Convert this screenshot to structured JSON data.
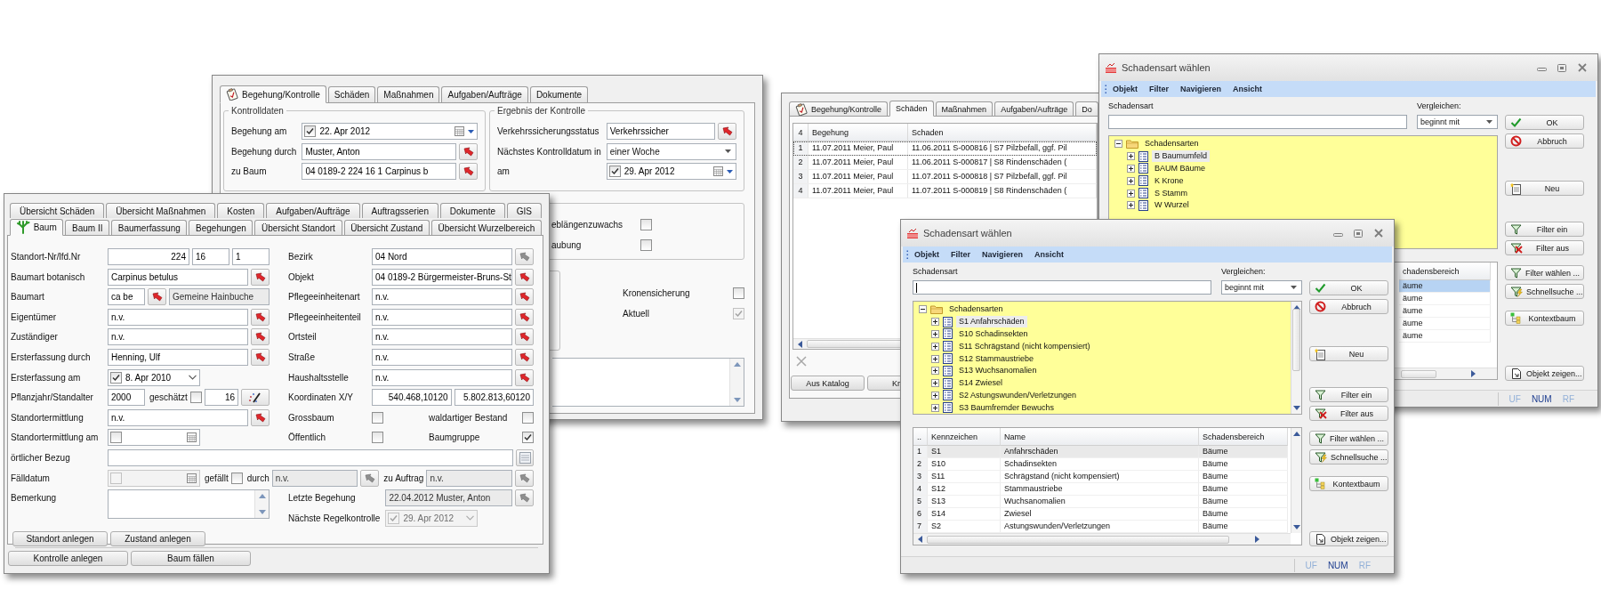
{
  "kontrolle_window": {
    "tabs": [
      {
        "label": "Begehung/Kontrolle",
        "selected": true
      },
      {
        "label": "Schäden",
        "selected": false
      },
      {
        "label": "Maßnahmen",
        "selected": false
      },
      {
        "label": "Aufgaben/Aufträge",
        "selected": false
      },
      {
        "label": "Dokumente",
        "selected": false
      }
    ],
    "groups": [
      {
        "title": "Kontrolldaten",
        "rows": [
          {
            "kind": "fields",
            "label": "Begehung am",
            "controls": [
              {
                "kind": "date-calendar-dropdown",
                "value": "22. Apr 2012",
                "checked": true,
                "disabled": false
              }
            ]
          },
          {
            "kind": "fields",
            "label": "Begehung durch",
            "controls": [
              {
                "kind": "field",
                "value": "Muster, Anton",
                "readonly": false
              },
              {
                "kind": "lookup",
                "disabled": false
              }
            ]
          },
          {
            "kind": "fields",
            "label": "zu Baum",
            "controls": [
              {
                "kind": "field",
                "value": "04 0189-2 224 16 1 Carpinus b",
                "readonly": false
              },
              {
                "kind": "lookup",
                "disabled": false
              }
            ]
          }
        ]
      },
      {
        "title": "Ergebnis der Kontrolle",
        "rows": [
          {
            "kind": "fields",
            "label": "Verkehrssicherungsstatus",
            "controls": [
              {
                "kind": "field",
                "value": "Verkehrssicher",
                "readonly": false
              },
              {
                "kind": "lookup",
                "disabled": false
              }
            ]
          },
          {
            "kind": "fields",
            "label": "Nächstes Kontrolldatum in",
            "controls": [
              {
                "kind": "combo",
                "value": "einer Woche"
              }
            ]
          },
          {
            "kind": "fields",
            "label": "am",
            "controls": [
              {
                "kind": "date-calendar-dropdown",
                "value": "29. Apr 2012",
                "checked": true,
                "disabled": false
              }
            ]
          }
        ]
      }
    ],
    "growth_checks": [
      {
        "label": "eblängenzuwachs",
        "checked": false
      },
      {
        "label": "aubung",
        "checked": false
      }
    ],
    "flags": [
      {
        "label": "Kronensicherung",
        "checked": false,
        "disabled": false
      },
      {
        "label": "Aktuell",
        "checked": true,
        "disabled": true
      }
    ]
  },
  "baum_window": {
    "tab_rows": [
      [
        {
          "label": "Übersicht Schäden",
          "selected": false
        },
        {
          "label": "Übersicht Maßnahmen",
          "selected": false
        },
        {
          "label": "Kosten",
          "selected": false
        },
        {
          "label": "Aufgaben/Aufträge",
          "selected": false
        },
        {
          "label": "Auftragsserien",
          "selected": false
        },
        {
          "label": "Dokumente",
          "selected": false
        },
        {
          "label": "GIS",
          "selected": false
        }
      ],
      [
        {
          "label": "Baum",
          "selected": true
        },
        {
          "label": "Baum II",
          "selected": false
        },
        {
          "label": "Baumerfassung",
          "selected": false
        },
        {
          "label": "Begehungen",
          "selected": false
        },
        {
          "label": "Übersicht Standort",
          "selected": false
        },
        {
          "label": "Übersicht Zustand",
          "selected": false
        },
        {
          "label": "Übersicht Wurzelbereich",
          "selected": false
        }
      ]
    ],
    "sections": [
      {
        "kind": "columns",
        "columns": [
          [
            {
              "kind": "fields",
              "label": "Standort-Nr/lfd.Nr",
              "controls": [
                {
                  "kind": "number",
                  "value": "224",
                  "readonly": false
                },
                {
                  "kind": "code",
                  "value": "16",
                  "readonly": false
                },
                {
                  "kind": "code",
                  "value": "1",
                  "readonly": false
                }
              ]
            },
            {
              "kind": "fields",
              "label": "Baumart botanisch",
              "controls": [
                {
                  "kind": "field",
                  "value": "Carpinus betulus",
                  "readonly": false
                },
                {
                  "kind": "lookup",
                  "disabled": false
                }
              ]
            },
            {
              "kind": "fields",
              "label": "Baumart",
              "controls": [
                {
                  "kind": "code",
                  "value": "ca be",
                  "readonly": false
                },
                {
                  "kind": "lookup",
                  "disabled": false
                },
                {
                  "kind": "field",
                  "value": "Gemeine Hainbuche",
                  "readonly": true
                }
              ]
            },
            {
              "kind": "fields",
              "label": "Eigentümer",
              "controls": [
                {
                  "kind": "field",
                  "value": "n.v.",
                  "readonly": false
                },
                {
                  "kind": "lookup",
                  "disabled": false
                }
              ]
            },
            {
              "kind": "fields",
              "label": "Zuständiger",
              "controls": [
                {
                  "kind": "field",
                  "value": "n.v.",
                  "readonly": false
                },
                {
                  "kind": "lookup",
                  "disabled": false
                }
              ]
            },
            {
              "kind": "fields",
              "label": "Ersterfassung durch",
              "controls": [
                {
                  "kind": "field",
                  "value": "Henning, Ulf",
                  "readonly": false
                },
                {
                  "kind": "lookup",
                  "disabled": false
                }
              ]
            },
            {
              "kind": "fields",
              "label": "Ersterfassung am",
              "controls": [
                {
                  "kind": "date-dropdown",
                  "value": "8. Apr 2010",
                  "checked": true,
                  "disabled": false
                }
              ]
            },
            {
              "kind": "fields",
              "label": "Pflanzjahr/Standalter",
              "controls": [
                {
                  "kind": "code",
                  "value": "2000",
                  "readonly": false
                },
                {
                  "kind": "caption",
                  "label": "geschätzt"
                },
                {
                  "kind": "check",
                  "checked": false
                },
                {
                  "kind": "number",
                  "value": "16",
                  "readonly": false
                },
                {
                  "kind": "tool"
                }
              ]
            },
            {
              "kind": "fields",
              "label": "Standortermittlung",
              "controls": [
                {
                  "kind": "field",
                  "value": "n.v.",
                  "readonly": false
                },
                {
                  "kind": "lookup",
                  "disabled": false
                }
              ]
            },
            {
              "kind": "fields",
              "label": "Standortermittlung am",
              "controls": [
                {
                  "kind": "date-calendar",
                  "checked": false,
                  "disabled": false
                }
              ]
            }
          ],
          [
            {
              "kind": "fields",
              "label": "Bezirk",
              "controls": [
                {
                  "kind": "field",
                  "value": "04 Nord",
                  "readonly": false
                },
                {
                  "kind": "lookup",
                  "disabled": true
                }
              ]
            },
            {
              "kind": "fields",
              "label": "Objekt",
              "controls": [
                {
                  "kind": "field",
                  "value": "04 0189-2 Bürgermeister-Bruns-St",
                  "readonly": false
                },
                {
                  "kind": "lookup",
                  "disabled": false
                }
              ]
            },
            {
              "kind": "fields",
              "label": "Pflegeeinheitenart",
              "controls": [
                {
                  "kind": "field",
                  "value": "n.v.",
                  "readonly": false
                },
                {
                  "kind": "lookup",
                  "disabled": false
                }
              ]
            },
            {
              "kind": "fields",
              "label": "Pflegeeinheitenteil",
              "controls": [
                {
                  "kind": "field",
                  "value": "n.v.",
                  "readonly": false
                },
                {
                  "kind": "lookup",
                  "disabled": false
                }
              ]
            },
            {
              "kind": "fields",
              "label": "Ortsteil",
              "controls": [
                {
                  "kind": "field",
                  "value": "n.v.",
                  "readonly": false
                },
                {
                  "kind": "lookup",
                  "disabled": false
                }
              ]
            },
            {
              "kind": "fields",
              "label": "Straße",
              "controls": [
                {
                  "kind": "field",
                  "value": "n.v.",
                  "readonly": false
                },
                {
                  "kind": "lookup",
                  "disabled": false
                }
              ]
            },
            {
              "kind": "fields",
              "label": "Haushaltsstelle",
              "controls": [
                {
                  "kind": "field",
                  "value": "n.v.",
                  "readonly": false
                },
                {
                  "kind": "lookup",
                  "disabled": false
                }
              ]
            },
            {
              "kind": "fields",
              "label": "Koordinaten X/Y",
              "controls": [
                {
                  "kind": "number",
                  "value": "540.468,10120",
                  "readonly": false
                },
                {
                  "kind": "number",
                  "value": "5.802.813,60120",
                  "readonly": false
                }
              ]
            },
            {
              "kind": "checks",
              "label": "Grossbaum",
              "controls": [
                {
                  "kind": "check",
                  "checked": false
                },
                {
                  "kind": "caption",
                  "label": "waldartiger Bestand"
                },
                {
                  "kind": "check",
                  "checked": false
                }
              ]
            },
            {
              "kind": "checks",
              "label": "Öffentlich",
              "controls": [
                {
                  "kind": "check",
                  "checked": false
                },
                {
                  "kind": "caption",
                  "label": "Baumgruppe"
                },
                {
                  "kind": "check",
                  "checked": true
                }
              ]
            }
          ]
        ]
      },
      {
        "kind": "wide",
        "rows": [
          {
            "kind": "fields",
            "label": "örtlicher Bezug",
            "controls": [
              {
                "kind": "field",
                "readonly": false
              },
              {
                "kind": "note"
              }
            ]
          },
          {
            "kind": "fields",
            "label": "Fälldatum",
            "controls": [
              {
                "kind": "date-calendar",
                "checked": false,
                "disabled": true
              },
              {
                "kind": "caption",
                "label": "gefällt"
              },
              {
                "kind": "check",
                "checked": false
              },
              {
                "kind": "caption",
                "label": "durch"
              },
              {
                "kind": "field",
                "value": "n.v.",
                "readonly": true
              },
              {
                "kind": "lookup",
                "disabled": true
              },
              {
                "kind": "caption",
                "label": "zu Auftrag"
              },
              {
                "kind": "field",
                "value": "n.v.",
                "readonly": true
              },
              {
                "kind": "lookup",
                "disabled": true
              }
            ]
          }
        ]
      },
      {
        "kind": "columns",
        "columns": [
          [
            {
              "kind": "fields",
              "label": "Bemerkung",
              "controls": [
                {
                  "kind": "memo"
                }
              ]
            }
          ],
          [
            {
              "kind": "fields",
              "label": "Letzte Begehung",
              "controls": [
                {
                  "kind": "field",
                  "value": "22.04.2012 Muster, Anton",
                  "readonly": true
                },
                {
                  "kind": "lookup",
                  "disabled": true
                }
              ]
            },
            {
              "kind": "fields",
              "label": "Nächste Regelkontrolle",
              "controls": [
                {
                  "kind": "date-dropdown",
                  "value": "29. Apr 2012",
                  "checked": true,
                  "disabled": true
                }
              ]
            }
          ]
        ]
      }
    ],
    "actions": [
      "Standort anlegen",
      "Zustand anlegen"
    ],
    "footer_actions": [
      "Kontrolle anlegen",
      "Baum fällen"
    ]
  },
  "schaeden_window": {
    "tabs": [
      {
        "label": "Begehung/Kontrolle",
        "selected": false
      },
      {
        "label": "Schäden",
        "selected": true
      },
      {
        "label": "Maßnahmen",
        "selected": false
      },
      {
        "label": "Aufgaben/Aufträge",
        "selected": false
      },
      {
        "label": "Do",
        "selected": false
      }
    ],
    "grid": {
      "columns": [
        "4",
        "Begehung",
        "Schaden"
      ],
      "rows": [
        {
          "cells": [
            "1",
            "11.07.2011 Meier, Paul",
            "11.06.2011 S-000816 | S7 Pilzbefall, ggf. Pil"
          ],
          "selected": true
        },
        {
          "cells": [
            "2",
            "11.07.2011 Meier, Paul",
            "11.06.2011 S-000817 | S8 Rindenschäden ("
          ],
          "selected": false
        },
        {
          "cells": [
            "3",
            "11.07.2011 Meier, Paul",
            "11.07.2011 S-000818 | S7 Pilzbefall, ggf. Pil"
          ],
          "selected": false
        },
        {
          "cells": [
            "4",
            "11.07.2011 Meier, Paul",
            "11.07.2011 S-000819 | S8 Rindenschäden ("
          ],
          "selected": false
        }
      ]
    },
    "buttons": [
      "Aus Katalog",
      "Kr"
    ]
  },
  "schadensart_window_back": {
    "title": "Schadensart wählen",
    "menu": [
      "Objekt",
      "Filter",
      "Navigieren",
      "Ansicht"
    ],
    "search_label": "Schadensart",
    "compare_label": "Vergleichen:",
    "compare_value": "beginnt mit",
    "tree": {
      "label": "Schadensarten",
      "expanded": true,
      "selected": false,
      "children": [
        {
          "label": "B Baumumfeld",
          "expanded": false,
          "selected": true
        },
        {
          "label": "BAUM Bäume",
          "expanded": false,
          "selected": false
        },
        {
          "label": "K Krone",
          "expanded": false,
          "selected": false
        },
        {
          "label": "S Stamm",
          "expanded": false,
          "selected": false
        },
        {
          "label": "W Wurzel",
          "expanded": false,
          "selected": false
        }
      ]
    },
    "grid": {
      "columns": [
        "chadensbereich"
      ],
      "rows": [
        {
          "cells": [
            "äume"
          ],
          "selected": true
        },
        {
          "cells": [
            "äume"
          ],
          "selected": false
        },
        {
          "cells": [
            "äume"
          ],
          "selected": false
        },
        {
          "cells": [
            "äume"
          ],
          "selected": false
        },
        {
          "cells": [
            "äume"
          ],
          "selected": false
        }
      ]
    },
    "buttons": [
      {
        "kind": "ok",
        "label": "OK"
      },
      {
        "kind": "cancel",
        "label": "Abbruch"
      },
      {
        "kind": "new",
        "label": "Neu"
      },
      {
        "kind": "filter-on",
        "label": "Filter ein"
      },
      {
        "kind": "filter-off",
        "label": "Filter aus"
      },
      {
        "kind": "filter-choose",
        "label": "Filter wählen ..."
      },
      {
        "kind": "quick-search",
        "label": "Schnellsuche ..."
      },
      {
        "kind": "context-tree",
        "label": "Kontextbaum"
      },
      {
        "kind": "show-object",
        "label": "Objekt zeigen..."
      }
    ],
    "status": [
      {
        "label": "UF",
        "on": false
      },
      {
        "label": "NUM",
        "on": true
      },
      {
        "label": "RF",
        "on": false
      }
    ]
  },
  "schadensart_window_front": {
    "title": "Schadensart wählen",
    "menu": [
      "Objekt",
      "Filter",
      "Navigieren",
      "Ansicht"
    ],
    "search_label": "Schadensart",
    "compare_label": "Vergleichen:",
    "compare_value": "beginnt mit",
    "tree": {
      "label": "Schadensarten",
      "expanded": true,
      "selected": false,
      "children": [
        {
          "label": "S1 Anfahrschäden",
          "expanded": false,
          "selected": true
        },
        {
          "label": "S10 Schadinsekten",
          "expanded": false,
          "selected": false
        },
        {
          "label": "S11 Schrägstand (nicht kompensiert)",
          "expanded": false,
          "selected": false
        },
        {
          "label": "S12 Stammaustriebe",
          "expanded": false,
          "selected": false
        },
        {
          "label": "S13 Wuchsanomalien",
          "expanded": false,
          "selected": false
        },
        {
          "label": "S14 Zwiesel",
          "expanded": false,
          "selected": false
        },
        {
          "label": "S2 Astungswunden/Verletzungen",
          "expanded": false,
          "selected": false
        },
        {
          "label": "S3 Baumfremder Bewuchs",
          "expanded": false,
          "selected": false
        }
      ]
    },
    "grid": {
      "columns": [
        "..",
        "Kennzeichen",
        "Name",
        "Schadensbereich"
      ],
      "rows": [
        {
          "cells": [
            "1",
            "S1",
            "Anfahrschäden",
            "Bäume"
          ],
          "selected": true
        },
        {
          "cells": [
            "2",
            "S10",
            "Schadinsekten",
            "Bäume"
          ],
          "selected": false
        },
        {
          "cells": [
            "3",
            "S11",
            "Schrägstand (nicht kompensiert)",
            "Bäume"
          ],
          "selected": false
        },
        {
          "cells": [
            "4",
            "S12",
            "Stammaustriebe",
            "Bäume"
          ],
          "selected": false
        },
        {
          "cells": [
            "5",
            "S13",
            "Wuchsanomalien",
            "Bäume"
          ],
          "selected": false
        },
        {
          "cells": [
            "6",
            "S14",
            "Zwiesel",
            "Bäume"
          ],
          "selected": false
        },
        {
          "cells": [
            "7",
            "S2",
            "Astungswunden/Verletzungen",
            "Bäume"
          ],
          "selected": false
        }
      ]
    },
    "buttons": [
      {
        "kind": "ok",
        "label": "OK"
      },
      {
        "kind": "cancel",
        "label": "Abbruch"
      },
      {
        "kind": "new",
        "label": "Neu"
      },
      {
        "kind": "filter-on",
        "label": "Filter ein"
      },
      {
        "kind": "filter-off",
        "label": "Filter aus"
      },
      {
        "kind": "filter-choose",
        "label": "Filter wählen ..."
      },
      {
        "kind": "quick-search",
        "label": "Schnellsuche ..."
      },
      {
        "kind": "context-tree",
        "label": "Kontextbaum"
      },
      {
        "kind": "show-object",
        "label": "Objekt zeigen..."
      }
    ],
    "status": [
      {
        "label": "UF",
        "on": false
      },
      {
        "label": "NUM",
        "on": true
      },
      {
        "label": "RF",
        "on": false
      }
    ]
  }
}
